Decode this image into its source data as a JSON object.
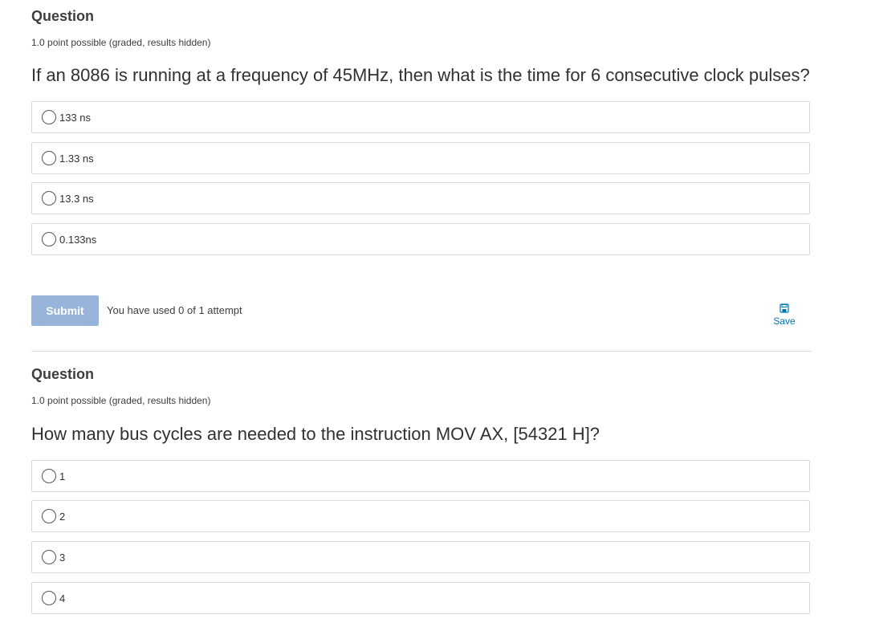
{
  "questions": [
    {
      "title": "Question",
      "meta": "1.0 point possible (graded, results hidden)",
      "text": "If an 8086 is running at a frequency of 45MHz, then what is the time for 6 consecutive clock pulses?",
      "choices": [
        "133 ns",
        "1.33 ns",
        "13.3 ns",
        "0.133ns"
      ],
      "submit_label": "Submit",
      "attempts_text": "You have used 0 of 1 attempt",
      "save_label": "Save"
    },
    {
      "title": "Question",
      "meta": "1.0 point possible (graded, results hidden)",
      "text": "How many bus cycles are needed to the instruction MOV AX, [54321 H]?",
      "choices": [
        "1",
        "2",
        "3",
        "4"
      ]
    }
  ],
  "colors": {
    "submit_bg": "#98b4da",
    "link": "#0075b4",
    "border": "#d9d9d9"
  },
  "icons": {
    "save": "save-icon"
  }
}
